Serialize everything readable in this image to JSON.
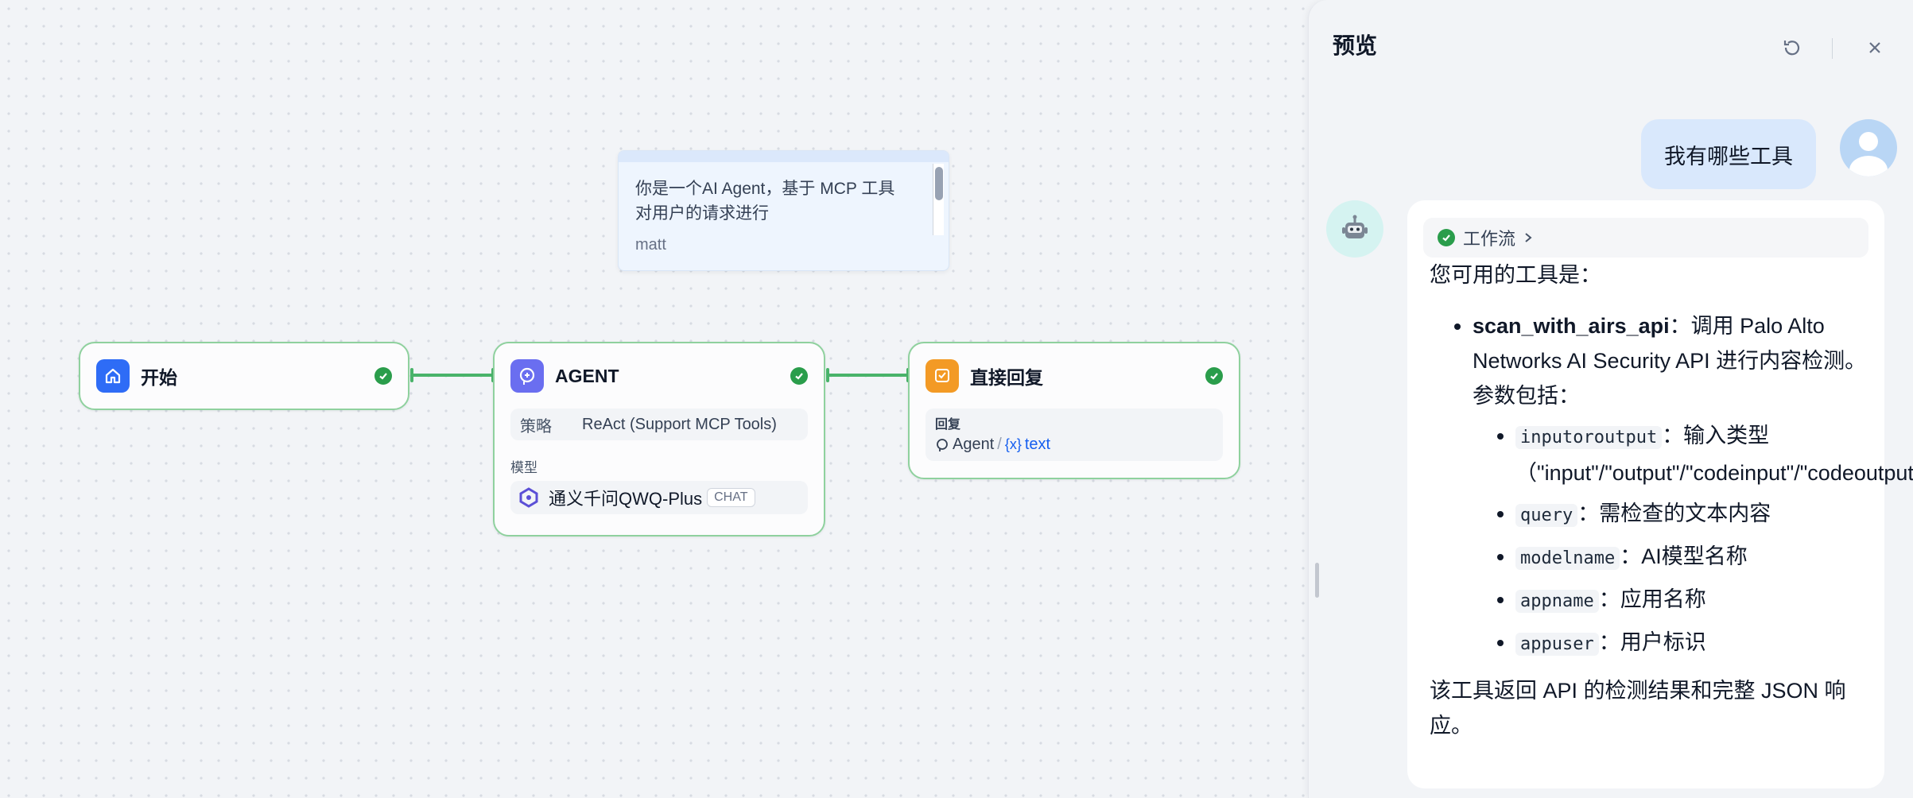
{
  "note": {
    "text": "你是一个AI Agent，基于 MCP 工具对用户的请求进行",
    "author": "matt"
  },
  "nodes": {
    "start": {
      "title": "开始"
    },
    "agent": {
      "title": "AGENT",
      "strategy_label": "策略",
      "strategy_value": "ReAct (Support MCP Tools)",
      "model_label": "模型",
      "model_value": "通义千问QWQ-Plus",
      "model_tag": "CHAT"
    },
    "reply": {
      "title": "直接回复",
      "reply_label": "回复",
      "ref_node": "Agent",
      "ref_sep": "/",
      "ref_var": "text"
    }
  },
  "panel": {
    "title": "预览",
    "user_message": "我有哪些工具",
    "workflow_chip": "工作流",
    "answer": {
      "intro": "您可用的工具是：",
      "tool_name": "scan_with_airs_api",
      "tool_desc": "：调用 Palo Alto Networks AI Security API 进行内容检测。参数包括：",
      "params": [
        {
          "name": "inputoroutput",
          "desc": "：输入类型（\"input\"/\"output\"/\"codeinput\"/\"codeoutput\"）"
        },
        {
          "name": "query",
          "desc": "：需检查的文本内容"
        },
        {
          "name": "modelname",
          "desc": "：AI模型名称"
        },
        {
          "name": "appname",
          "desc": "：应用名称"
        },
        {
          "name": "appuser",
          "desc": "：用户标识"
        }
      ],
      "outro": "该工具返回 API 的检测结果和完整 JSON 响应。"
    }
  },
  "colors": {
    "node_border": "#8fd19e",
    "connector": "#49b36a",
    "check": "#2a9d4b",
    "start_icon": "#2e6cf6",
    "agent_icon": "#6a6ef0",
    "reply_icon": "#f39a25",
    "var_blue": "#155eef"
  },
  "icons": [
    "home-icon",
    "brain-icon",
    "reply-icon",
    "check-icon",
    "refresh-icon",
    "close-icon",
    "robot-icon",
    "user-icon",
    "chevron-right-icon",
    "variable-icon"
  ]
}
